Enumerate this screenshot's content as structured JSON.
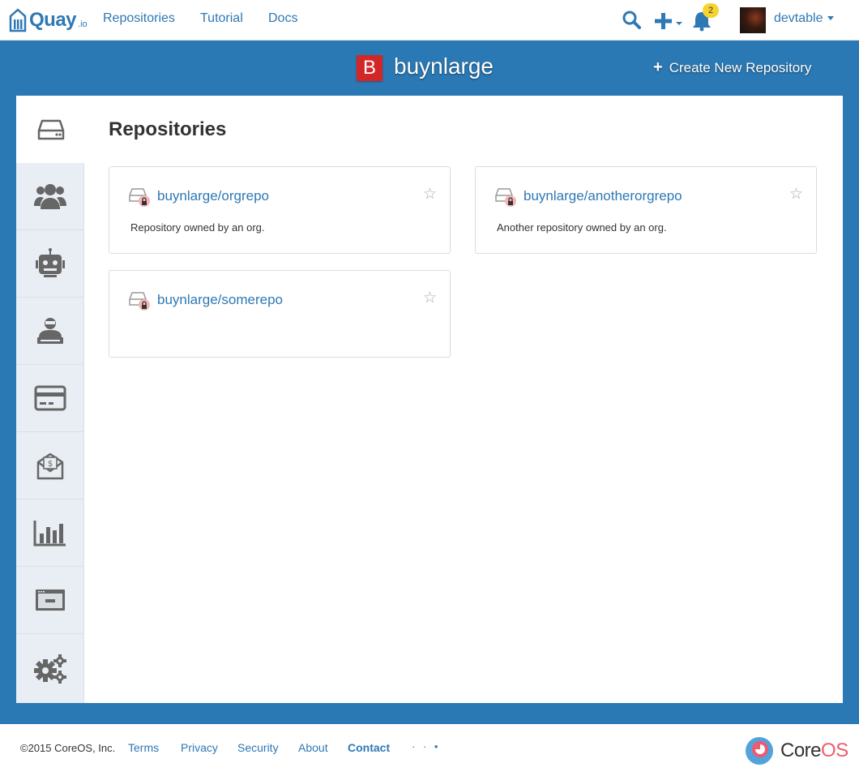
{
  "nav": {
    "logo": "Quay",
    "logo_suffix": ".io",
    "links": [
      "Repositories",
      "Tutorial",
      "Docs"
    ],
    "notification_count": "2",
    "username": "devtable"
  },
  "header": {
    "org_initial": "B",
    "org_name": "buynlarge",
    "create_button": "Create New Repository",
    "org_badge_color": "#d32626"
  },
  "sidebar": {
    "tabs": [
      "repositories-icon",
      "teams-icon",
      "robot-accounts-icon",
      "default-permissions-icon",
      "billing-icon",
      "invoices-icon",
      "usage-logs-icon",
      "applications-icon",
      "settings-icon"
    ]
  },
  "main": {
    "title": "Repositories",
    "repos": [
      {
        "name": "buynlarge/orgrepo",
        "description": "Repository owned by an org."
      },
      {
        "name": "buynlarge/anotherorgrepo",
        "description": "Another repository owned by an org."
      },
      {
        "name": "buynlarge/somerepo",
        "description": ""
      }
    ]
  },
  "footer": {
    "copyright": "©2015 CoreOS, Inc.",
    "links": [
      "Terms",
      "Privacy",
      "Security",
      "About",
      "Contact"
    ],
    "dots": "· · •",
    "brand_core": "Core",
    "brand_os": "OS"
  },
  "colors": {
    "accent": "#2e78b4",
    "band": "#2b79b4",
    "badge": "#f6d330",
    "lock": "#e8555a"
  }
}
